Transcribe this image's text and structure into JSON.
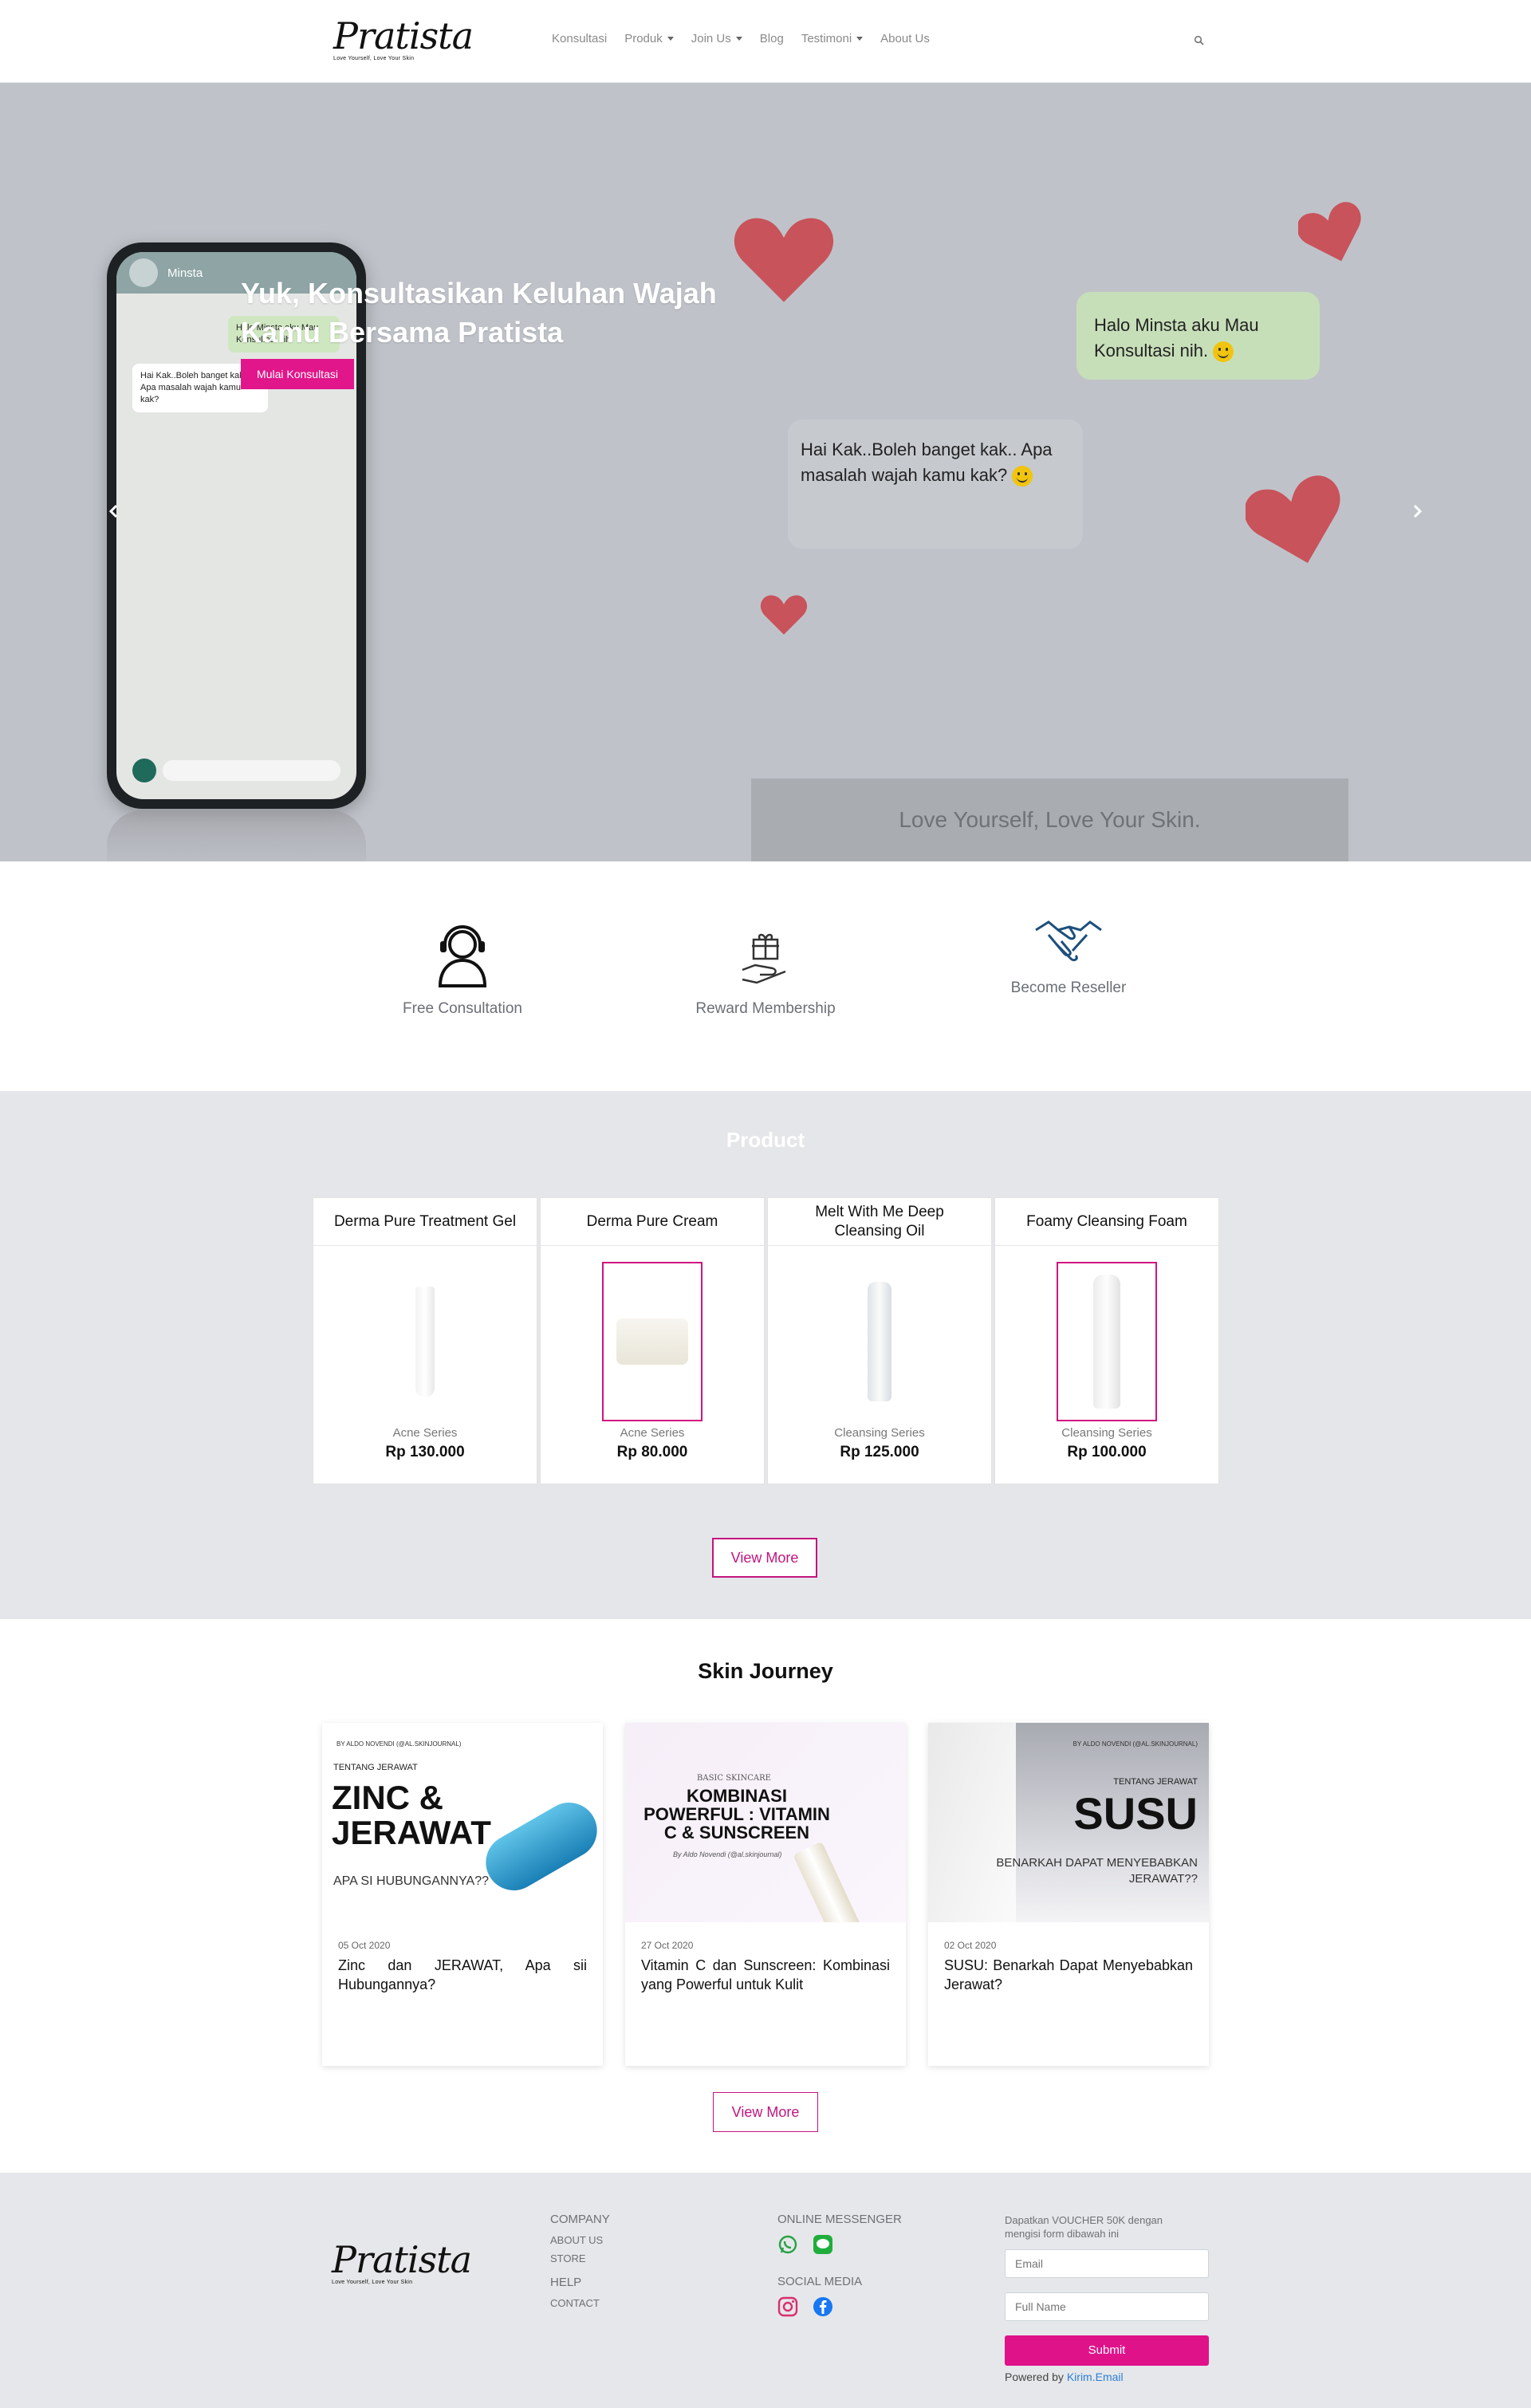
{
  "brand": {
    "logo": "Pratista",
    "tagline": "Love Yourself, Love Your Skin"
  },
  "nav": {
    "items": [
      {
        "label": "Konsultasi",
        "dropdown": false
      },
      {
        "label": "Produk",
        "dropdown": true
      },
      {
        "label": "Join Us",
        "dropdown": true
      },
      {
        "label": "Blog",
        "dropdown": false
      },
      {
        "label": "Testimoni",
        "dropdown": true
      },
      {
        "label": "About Us",
        "dropdown": false
      }
    ],
    "search_icon": "search-icon"
  },
  "hero": {
    "title": "Yuk, Konsultasikan Keluhan Wajah Kamu Bersama Pratista",
    "cta": "Mulai Konsultasi",
    "bubble_out": "Halo Minsta aku Mau Konsultasi nih.",
    "bubble_in": "Hai Kak..Boleh banget kak.. Apa masalah wajah kamu kak?",
    "phone_contact": "Minsta",
    "phone_msg_out": "Halo Minsta aku Mau Konsultasi nih.",
    "phone_msg_in": "Hai Kak..Boleh banget kak.. Apa masalah wajah kamu kak?",
    "slogan": "Love Yourself, Love Your Skin."
  },
  "features": [
    {
      "label": "Free Consultation",
      "icon": "headset-user-icon"
    },
    {
      "label": "Reward Membership",
      "icon": "gift-hand-icon"
    },
    {
      "label": "Become Reseller",
      "icon": "handshake-icon"
    }
  ],
  "products": {
    "title": "Product",
    "items": [
      {
        "name": "Derma Pure Treatment Gel",
        "series": "Acne Series",
        "price": "Rp 130.000"
      },
      {
        "name": "Derma Pure Cream",
        "series": "Acne Series",
        "price": "Rp 80.000"
      },
      {
        "name": "Melt With Me Deep Cleansing Oil",
        "series": "Cleansing Series",
        "price": "Rp 125.000"
      },
      {
        "name": "Foamy Cleansing Foam",
        "series": "Cleansing Series",
        "price": "Rp 100.000"
      }
    ],
    "view_more": "View More"
  },
  "journey": {
    "title": "Skin Journey",
    "posts": [
      {
        "date": "05 Oct 2020",
        "title": "Zinc dan JERAWAT, Apa sii Hubungannya?",
        "img_kicker": "TENTANG JERAWAT",
        "img_headline": "ZINC & JERAWAT",
        "img_sub": "APA SI HUBUNGANNYA??",
        "img_byline": "BY ALDO NOVENDI (@AL.SKINJOURNAL)"
      },
      {
        "date": "27 Oct 2020",
        "title": "Vitamin C dan Sunscreen: Kombinasi yang Powerful untuk Kulit",
        "img_kicker": "BASIC SKINCARE",
        "img_headline": "KOMBINASI POWERFUL : VITAMIN C & SUNSCREEN",
        "img_byline": "By Aldo Novendi (@al.skinjournal)"
      },
      {
        "date": "02 Oct 2020",
        "title": "SUSU: Benarkah Dapat Menyebabkan Jerawat?",
        "img_kicker": "TENTANG JERAWAT",
        "img_headline": "SUSU",
        "img_sub": "BENARKAH DAPAT MENYEBABKAN JERAWAT??",
        "img_byline": "BY ALDO NOVENDI (@AL.SKINJOURNAL)"
      }
    ],
    "view_more": "View More"
  },
  "footer": {
    "company_head": "COMPANY",
    "company_links": [
      "ABOUT US",
      "STORE"
    ],
    "help_head": "HELP",
    "help_links": [
      "CONTACT"
    ],
    "messenger_head": "ONLINE MESSENGER",
    "social_head": "SOCIAL MEDIA",
    "voucher_text": "Dapatkan VOUCHER 50K dengan mengisi form dibawah ini",
    "email_placeholder": "Email",
    "name_placeholder": "Full Name",
    "submit": "Submit",
    "powered_by": "Powered by",
    "powered_link": "Kirim.Email"
  },
  "colors": {
    "accent": "#e0168a",
    "hero_bg": "#bfc3c9",
    "section_bg": "#e5e6e9"
  }
}
